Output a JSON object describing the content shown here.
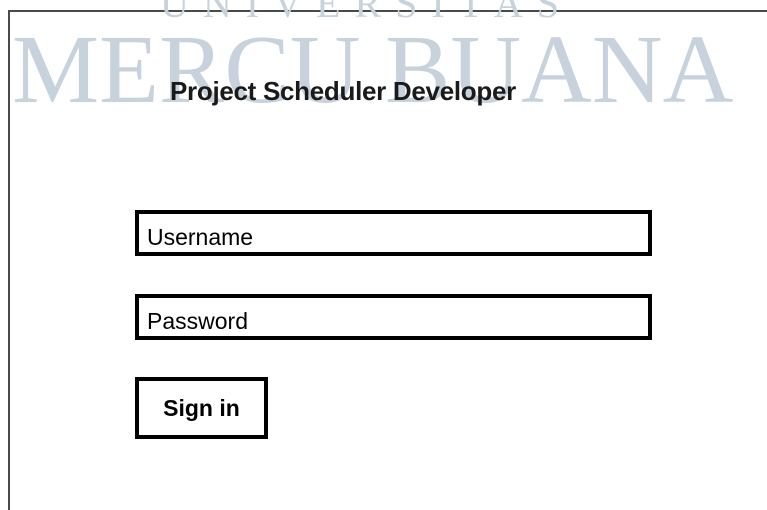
{
  "watermark": {
    "text": "MERCU BUANA",
    "top_text": "UNIVERSITAS"
  },
  "app": {
    "title": "Project Scheduler Developer"
  },
  "form": {
    "username_placeholder": "Username",
    "password_placeholder": "Password",
    "signin_label": "Sign in"
  },
  "colors": {
    "watermark": "#c8d2dc",
    "border": "#000000",
    "frame": "#4a4a4a"
  }
}
